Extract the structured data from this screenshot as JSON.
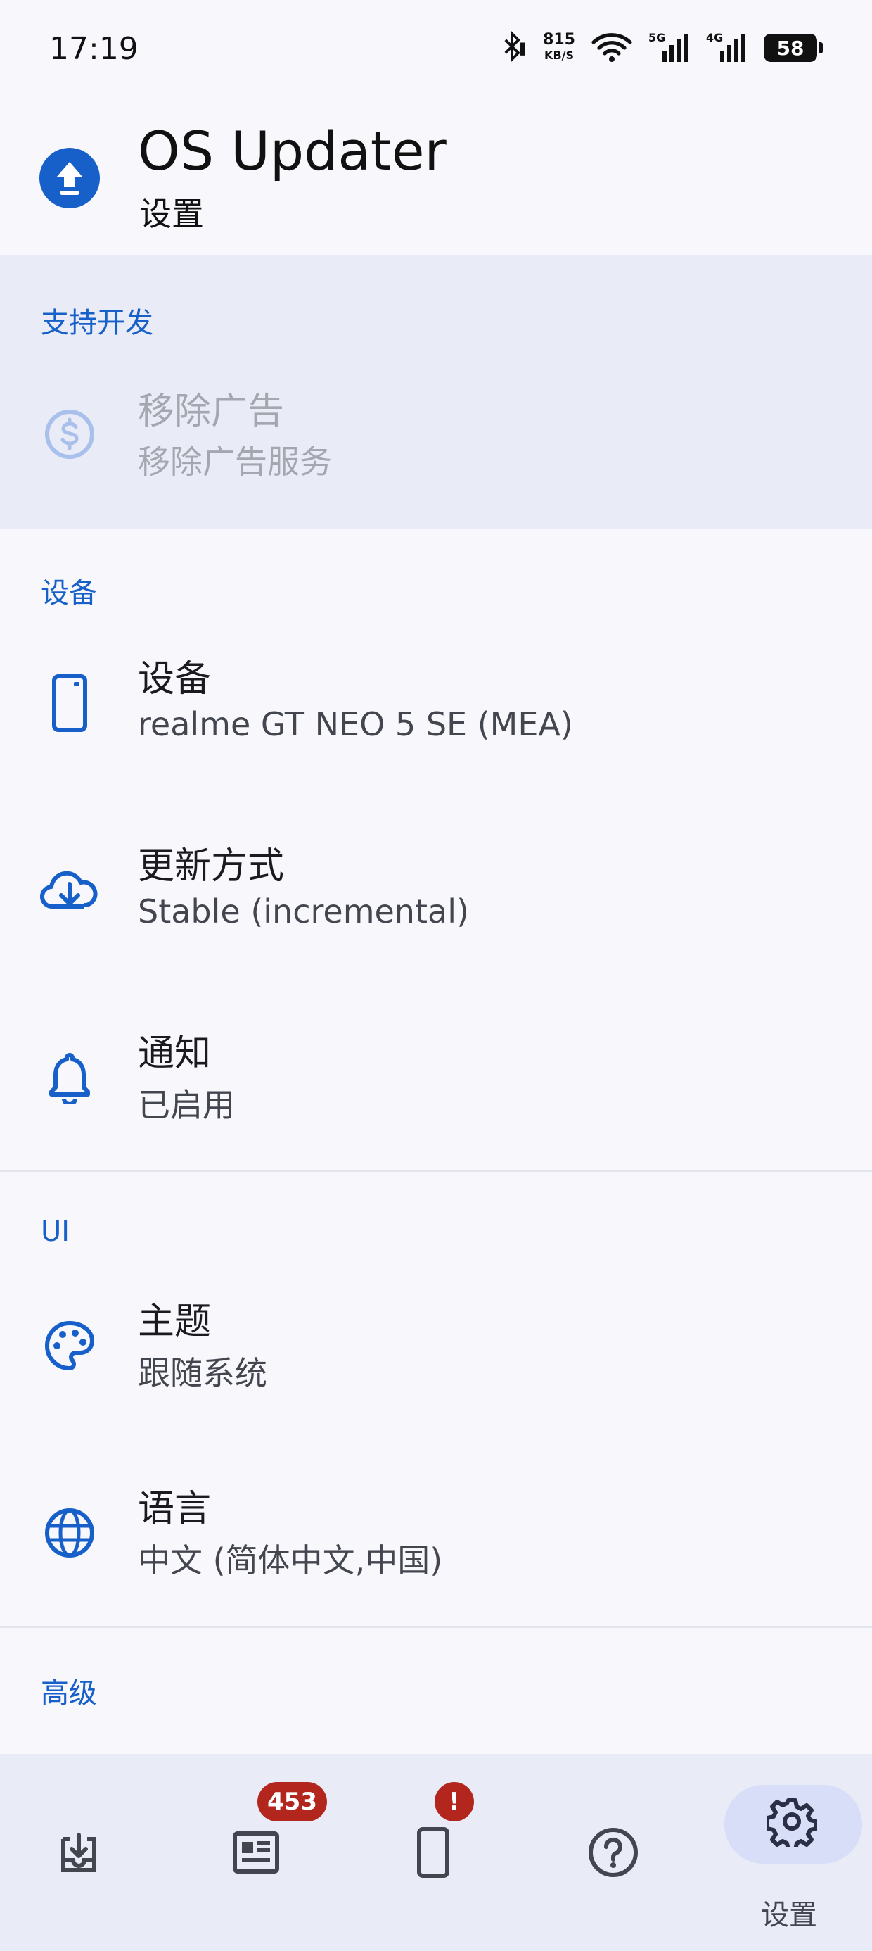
{
  "status_bar": {
    "time": "17:19",
    "net_speed_value": "815",
    "net_speed_unit": "KB/S",
    "signal_1_label": "5G",
    "signal_2_label": "4G",
    "battery_level": "58"
  },
  "app_bar": {
    "title": "OS Updater",
    "subtitle": "设置",
    "logo_icon": "upload-circle-icon"
  },
  "sections": {
    "support": {
      "header": "支持开发",
      "remove_ads": {
        "title": "移除广告",
        "desc": "移除广告服务",
        "icon": "dollar-circle-icon",
        "enabled": false
      }
    },
    "device": {
      "header": "设备",
      "device": {
        "title": "设备",
        "desc": "realme GT NEO 5 SE (MEA)",
        "icon": "phone-icon"
      },
      "update_method": {
        "title": "更新方式",
        "desc": "Stable (incremental)",
        "icon": "cloud-download-icon"
      },
      "notifications": {
        "title": "通知",
        "desc": "已启用",
        "icon": "bell-icon"
      }
    },
    "ui": {
      "header": "UI",
      "theme": {
        "title": "主题",
        "desc": "跟随系统",
        "icon": "palette-icon"
      },
      "language": {
        "title": "语言",
        "desc": "中文 (简体中文,中国)",
        "icon": "globe-icon"
      }
    },
    "advanced": {
      "header": "高级"
    }
  },
  "bottom_nav": {
    "items": [
      {
        "name": "updates",
        "icon": "download-tray-icon"
      },
      {
        "name": "news",
        "icon": "news-icon",
        "badge": "453"
      },
      {
        "name": "device",
        "icon": "phone-alert-icon",
        "badge": "!"
      },
      {
        "name": "help",
        "icon": "help-circle-icon"
      },
      {
        "name": "settings",
        "icon": "gear-icon",
        "label": "设置",
        "selected": true
      }
    ]
  },
  "colors": {
    "accent": "#1760c9",
    "background": "#f7f7fc",
    "disabled_band": "#e9ebf6",
    "badge": "#b3261e",
    "nav_background": "#e9ebf7",
    "nav_selected_pill": "#d8ddf8"
  }
}
